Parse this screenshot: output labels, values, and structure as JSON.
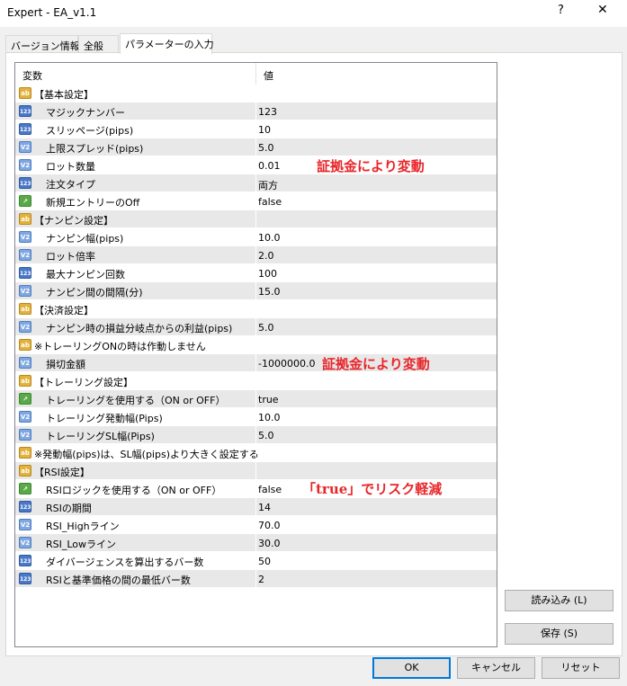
{
  "window": {
    "title": "Expert - EA_v1.1",
    "help_label": "?",
    "close_label": "✕"
  },
  "tabs": [
    {
      "label": "バージョン情報"
    },
    {
      "label": "全般"
    },
    {
      "label": "パラメーターの入力"
    }
  ],
  "grid": {
    "headers": {
      "variable": "変数",
      "value": "値"
    },
    "rows": [
      {
        "type": "ab",
        "name": "【基本設定】",
        "value": ""
      },
      {
        "type": "123",
        "name": "マジックナンバー",
        "value": "123"
      },
      {
        "type": "123",
        "name": "スリッページ(pips)",
        "value": "10"
      },
      {
        "type": "v2",
        "name": "上限スプレッド(pips)",
        "value": "5.0"
      },
      {
        "type": "v2",
        "name": "ロット数量",
        "value": "0.01"
      },
      {
        "type": "123",
        "name": "注文タイプ",
        "value": "両方"
      },
      {
        "type": "bool",
        "name": "新規エントリーのOff",
        "value": "false"
      },
      {
        "type": "ab",
        "name": "【ナンピン設定】",
        "value": ""
      },
      {
        "type": "v2",
        "name": "ナンピン幅(pips)",
        "value": "10.0"
      },
      {
        "type": "v2",
        "name": "ロット倍率",
        "value": "2.0"
      },
      {
        "type": "123",
        "name": "最大ナンピン回数",
        "value": "100"
      },
      {
        "type": "v2",
        "name": "ナンピン間の間隔(分)",
        "value": "15.0"
      },
      {
        "type": "ab",
        "name": "【決済設定】",
        "value": ""
      },
      {
        "type": "v2",
        "name": "ナンピン時の損益分岐点からの利益(pips)",
        "value": "5.0"
      },
      {
        "type": "ab",
        "name": "※トレーリングONの時は作動しません",
        "value": ""
      },
      {
        "type": "v2",
        "name": "損切金額",
        "value": "-1000000.0"
      },
      {
        "type": "ab",
        "name": "【トレーリング設定】",
        "value": ""
      },
      {
        "type": "bool",
        "name": "トレーリングを使用する（ON or OFF）",
        "value": "true"
      },
      {
        "type": "v2",
        "name": "トレーリング発動幅(Pips)",
        "value": "10.0"
      },
      {
        "type": "v2",
        "name": "トレーリングSL幅(Pips)",
        "value": "5.0"
      },
      {
        "type": "ab",
        "name": "※発動幅(pips)は、SL幅(pips)より大きく設定する",
        "value": ""
      },
      {
        "type": "ab",
        "name": "【RSI設定】",
        "value": ""
      },
      {
        "type": "bool",
        "name": "RSIロジックを使用する（ON or OFF）",
        "value": "false"
      },
      {
        "type": "123",
        "name": "RSIの期間",
        "value": "14"
      },
      {
        "type": "v2",
        "name": "RSI_Highライン",
        "value": "70.0"
      },
      {
        "type": "v2",
        "name": "RSI_Lowライン",
        "value": "30.0"
      },
      {
        "type": "123",
        "name": "ダイバージェンスを算出するバー数",
        "value": "50"
      },
      {
        "type": "123",
        "name": "RSIと基準価格の間の最低バー数",
        "value": "2"
      }
    ]
  },
  "icon_labels": {
    "ab": "ab",
    "123": "123",
    "v2": "V2",
    "bool": "↗"
  },
  "annotations": {
    "lot": "証拠金により変動",
    "stoploss": "証拠金により変動",
    "rsi": "「true」でリスク軽減"
  },
  "buttons": {
    "load": "読み込み (L)",
    "save": "保存 (S)",
    "ok": "OK",
    "cancel": "キャンセル",
    "reset": "リセット"
  },
  "colors": {
    "annotation": "#e8262a",
    "ok_border": "#0078d7"
  }
}
